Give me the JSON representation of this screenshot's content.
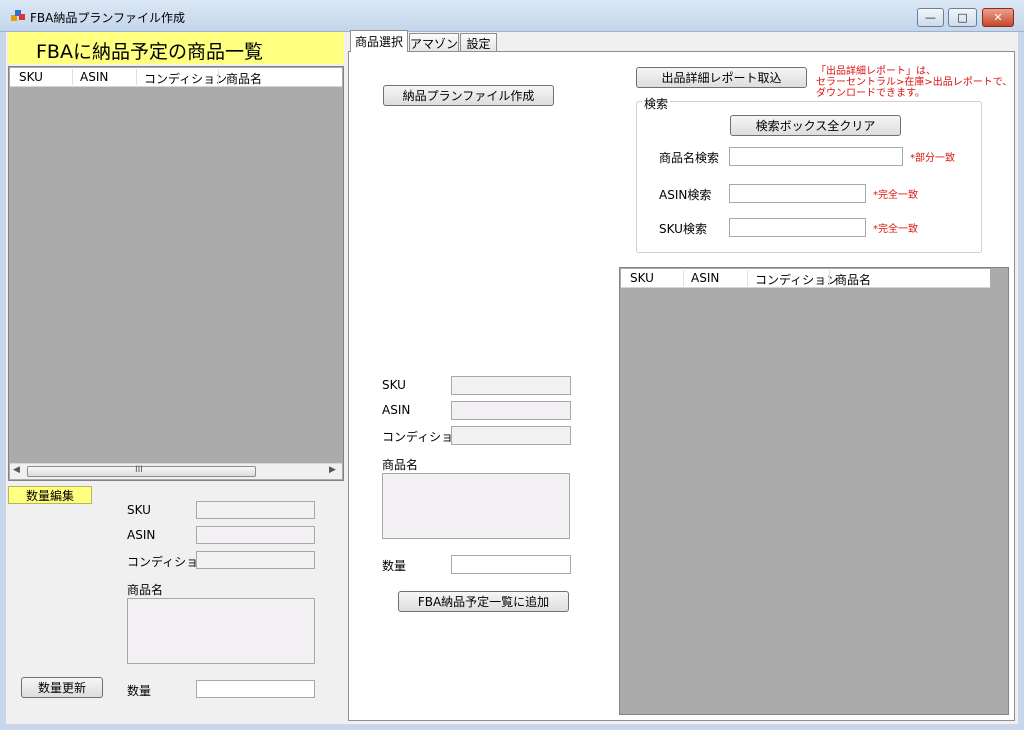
{
  "window": {
    "title": "FBA納品プランファイル作成",
    "controls": [
      "—",
      "□",
      "✕"
    ]
  },
  "left_panel": {
    "header": "FBAに納品予定の商品一覧",
    "list_columns": [
      "SKU",
      "ASIN",
      "コンディション",
      "商品名"
    ],
    "scroll_grip": "III",
    "edit_button": "数量編集",
    "fields": {
      "sku": "SKU",
      "asin": "ASIN",
      "condition": "コンディション",
      "name": "商品名",
      "qty": "数量"
    },
    "update_button": "数量更新"
  },
  "tabs": [
    {
      "label": "商品選択"
    },
    {
      "label": "アマゾン"
    },
    {
      "label": "設定"
    }
  ],
  "main": {
    "create_plan_button": "納品プランファイル作成",
    "import_report_button": "出品詳細レポート取込",
    "report_note": "「出品詳細レポート」は、\nセラーセントラル>在庫>出品レポートで、\nダウンロードできます。",
    "search": {
      "legend": "検索",
      "clear_button": "検索ボックス全クリア",
      "name_label": "商品名検索",
      "name_note": "*部分一致",
      "asin_label": "ASIN検索",
      "asin_note": "*完全一致",
      "sku_label": "SKU検索",
      "sku_note": "*完全一致"
    },
    "fields": {
      "sku": "SKU",
      "asin": "ASIN",
      "condition": "コンディション",
      "name": "商品名",
      "qty": "数量"
    },
    "add_button": "FBA納品予定一覧に追加",
    "list_columns": [
      "SKU",
      "ASIN",
      "コンディション",
      "商品名"
    ]
  }
}
